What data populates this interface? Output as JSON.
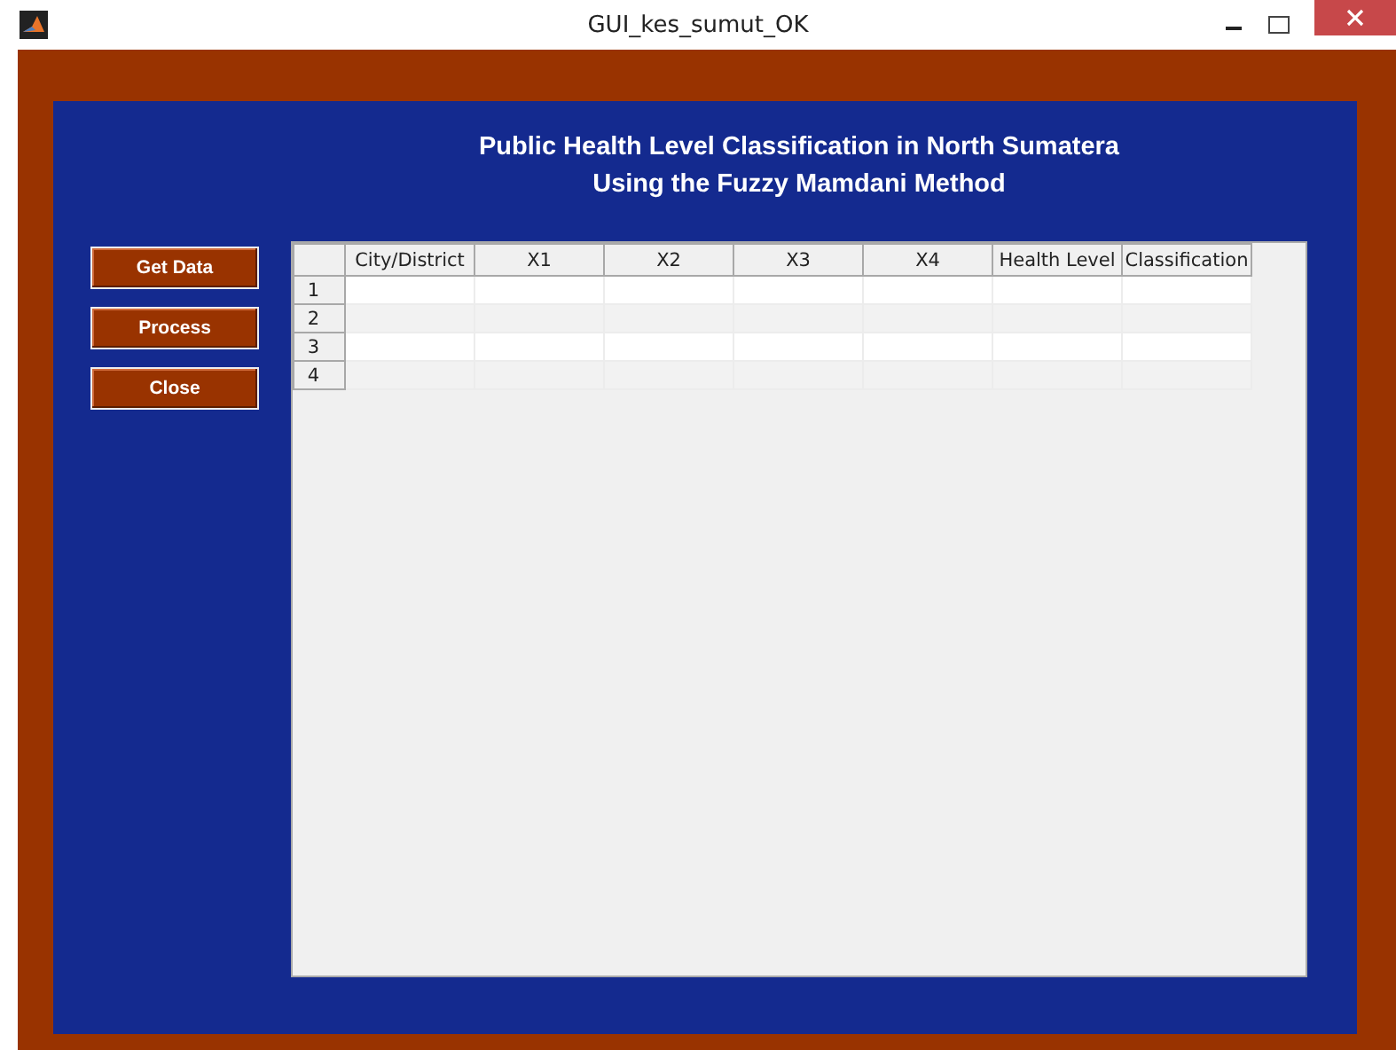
{
  "window": {
    "title": "GUI_kes_sumut_OK"
  },
  "heading": [
    "Public Health Level Classification in North Sumatera",
    "Using the Fuzzy Mamdani Method"
  ],
  "buttons": [
    "Get Data",
    "Process",
    "Close"
  ],
  "table": {
    "columns": [
      "City/District",
      "X1",
      "X2",
      "X3",
      "X4",
      "Health Level",
      "Classification"
    ],
    "rows": [
      "1",
      "2",
      "3",
      "4"
    ]
  }
}
